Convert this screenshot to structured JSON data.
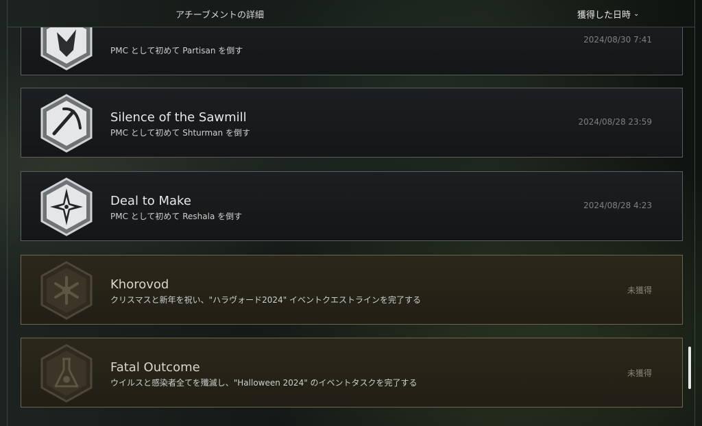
{
  "header": {
    "title": "アチーブメントの詳細",
    "sort_label": "獲得した日時"
  },
  "achievements": [
    {
      "name": "",
      "description": "PMC として初めて Partisan を倒す",
      "date": "2024/08/30 7:41",
      "icon": "wolf-icon",
      "unlocked": true
    },
    {
      "name": "Silence of the Sawmill",
      "description": "PMC として初めて Shturman を倒す",
      "date": "2024/08/28 23:59",
      "icon": "pickaxe-icon",
      "unlocked": true
    },
    {
      "name": "Deal to Make",
      "description": "PMC として初めて Reshala を倒す",
      "date": "2024/08/28 4:23",
      "icon": "compass-star-icon",
      "unlocked": true
    },
    {
      "name": "Khorovod",
      "description": "クリスマスと新年を祝い、\"ハラヴォード2024\" イベントクエストラインを完了する",
      "date": "未獲得",
      "icon": "snowflake-icon",
      "unlocked": false
    },
    {
      "name": "Fatal Outcome",
      "description": "ウイルスと感染者全てを殲滅し、\"Halloween 2024\" のイベントタスクを完了する",
      "date": "未獲得",
      "icon": "flask-skull-icon",
      "unlocked": false
    }
  ],
  "colors": {
    "locked_border": "#6d6650",
    "unlocked_border": "#5a6062"
  }
}
